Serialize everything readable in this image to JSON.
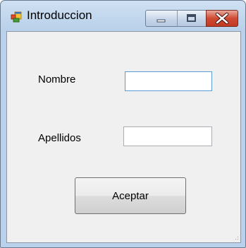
{
  "window": {
    "title": "Introduccion",
    "app_icon": "windows-form-icon",
    "caption_buttons": [
      "minimize-icon",
      "maximize-icon",
      "close-icon"
    ]
  },
  "form": {
    "nombre_label": "Nombre",
    "nombre_value": "",
    "apellidos_label": "Apellidos",
    "apellidos_value": "",
    "submit_label": "Aceptar"
  },
  "colors": {
    "title_bar": "#b9d1ea",
    "client_bg": "#f0f0f0",
    "close_button": "#c13a24",
    "focused_input_border": "#5b9bd5"
  }
}
